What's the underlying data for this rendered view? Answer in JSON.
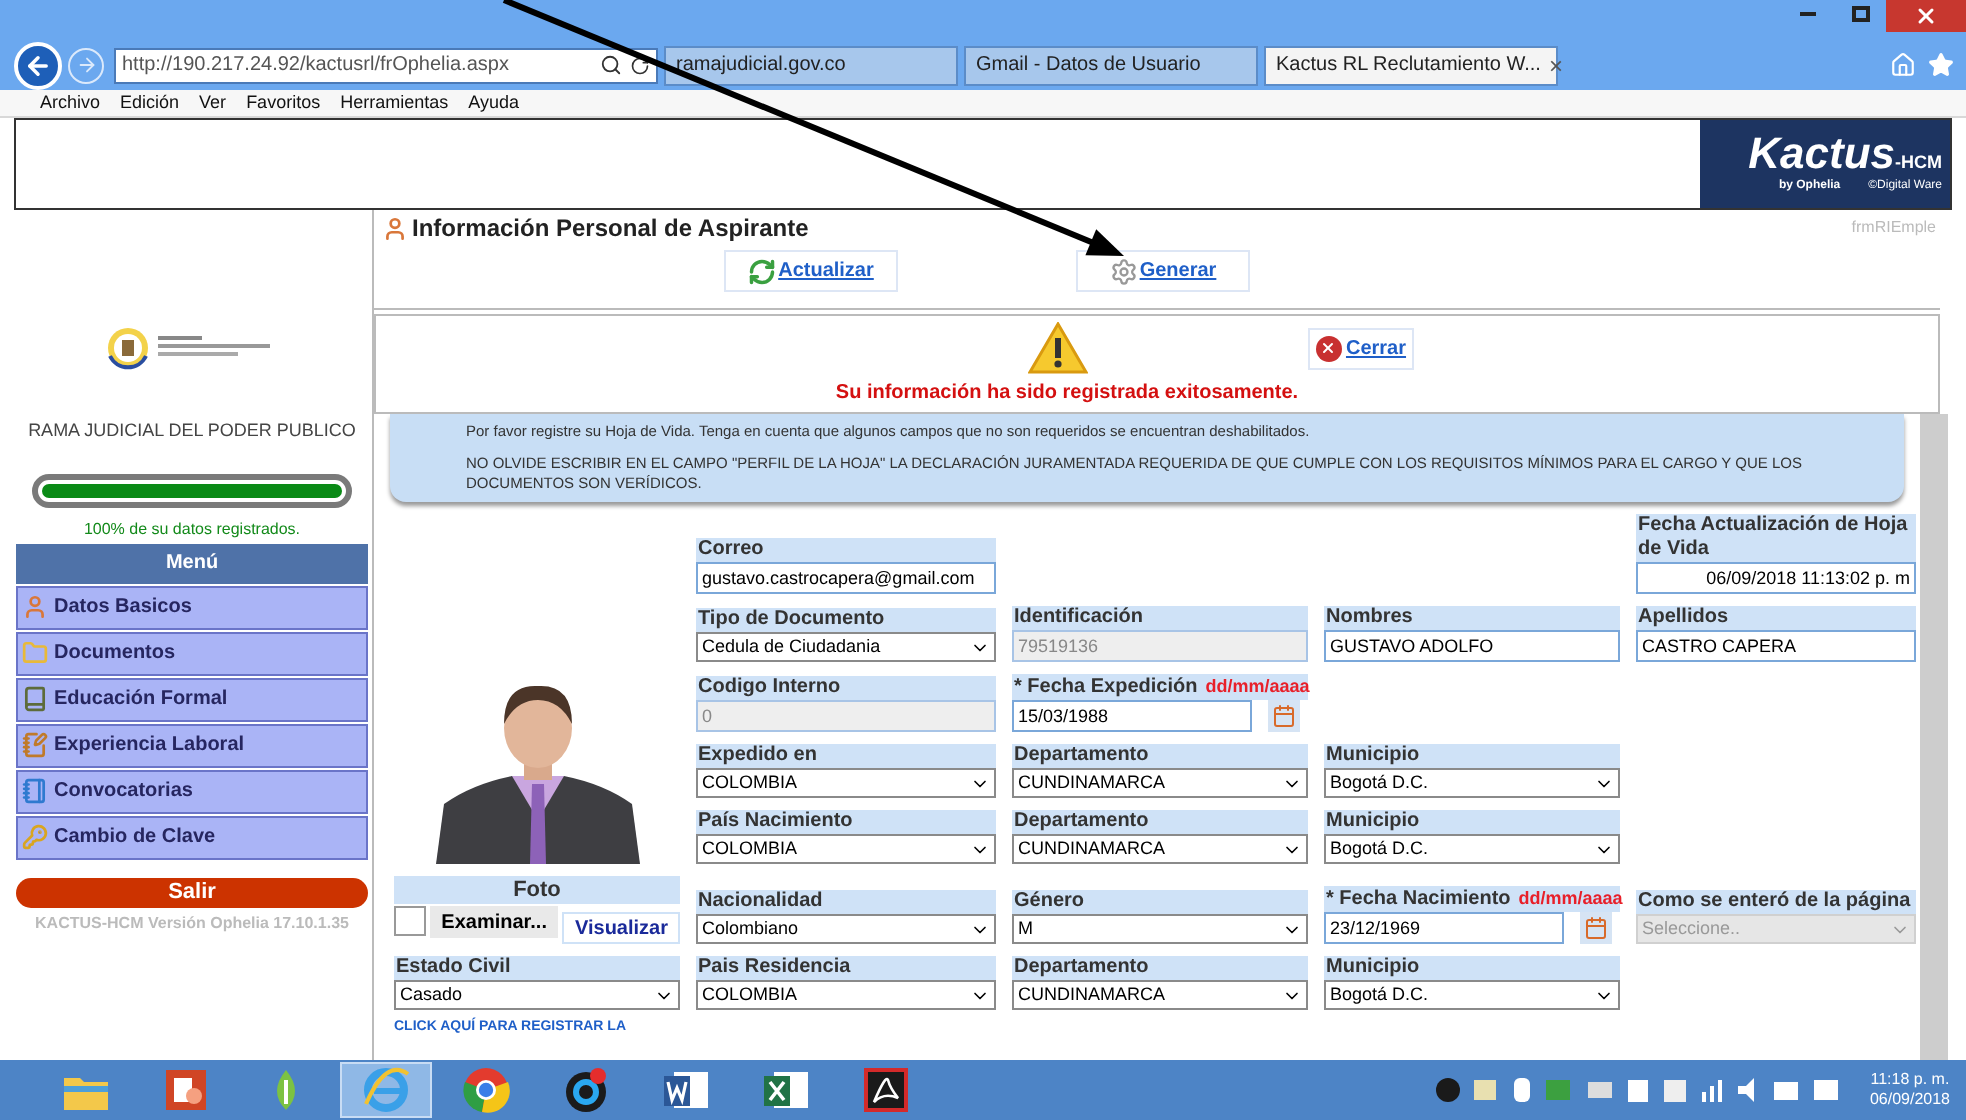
{
  "browser": {
    "url": "http://190.217.24.92/kactusrl/frOphelia.aspx",
    "tabs": [
      {
        "title": "ramajudicial.gov.co",
        "selected": false
      },
      {
        "title": "Gmail - Datos de Usuario",
        "selected": false
      },
      {
        "title": "Kactus RL Reclutamiento W...",
        "selected": true,
        "close": "×"
      }
    ],
    "menu": [
      "Archivo",
      "Edición",
      "Ver",
      "Favoritos",
      "Herramientas",
      "Ayuda"
    ]
  },
  "logo": {
    "name": "Kactus",
    "suffix": "-HCM",
    "tagline": "by Ophelia",
    "credit": "©Digital Ware"
  },
  "sidebar": {
    "organization": "RAMA JUDICIAL DEL PODER PUBLICO",
    "progress": {
      "level": 1,
      "caption": "100% de su datos registrados."
    },
    "menu_title": "Menú",
    "items": [
      {
        "label": "Datos Basicos",
        "kind": "user"
      },
      {
        "label": "Documentos",
        "kind": "folder"
      },
      {
        "label": "Educación Formal",
        "kind": "book"
      },
      {
        "label": "Experiencia Laboral",
        "kind": "notebook"
      },
      {
        "label": "Convocatorias",
        "kind": "binder"
      },
      {
        "label": "Cambio de Clave",
        "kind": "key"
      }
    ],
    "logout": "Salir",
    "version": "KACTUS-HCM Versión Ophelia 17.10.1.35"
  },
  "page": {
    "title": "Información Personal de Aspirante",
    "form_id": "frmRIEmple",
    "actions": [
      {
        "label": "Actualizar",
        "kind": "refresh"
      },
      {
        "label": "Generar",
        "kind": "gear"
      }
    ],
    "message": {
      "text": "Su información ha sido registrada exitosamente.",
      "close": "Cerrar"
    },
    "notices": [
      "Por favor registre su Hoja de Vida. Tenga en cuenta que algunos campos que no son requeridos se encuentran deshabilitados.",
      "NO OLVIDE ESCRIBIR EN EL CAMPO \"PERFIL DE LA HOJA\" LA DECLARACIÓN JURAMENTADA REQUERIDA DE QUE CUMPLE CON LOS REQUISITOS MÍNIMOS PARA EL CARGO Y QUE LOS DOCUMENTOS SON VERÍDICOS."
    ]
  },
  "form": {
    "photo": {
      "kind": "picture"
    },
    "rows": [
      [
        {
          "kind": "input",
          "label": "Correo",
          "value": "gustavo.castrocapera@gmail.com",
          "disabled": false
        },
        {
          "kind": "empty"
        },
        {
          "kind": "empty"
        },
        {
          "kind": "timestamp",
          "label": "Fecha Actualización de Hoja de Vida",
          "value": "06/09/2018 11:13:02 p. m",
          "disabled": false
        }
      ],
      [
        {
          "kind": "select",
          "label": "Tipo de Documento",
          "value": "Cedula de Ciudadania",
          "disabled": false
        },
        {
          "kind": "input",
          "label": "Identificación",
          "value": "79519136",
          "disabled": true
        },
        {
          "kind": "input",
          "label": "Nombres",
          "value": "GUSTAVO ADOLFO",
          "disabled": false
        },
        {
          "kind": "input",
          "label": "Apellidos",
          "value": "CASTRO CAPERA",
          "disabled": false
        }
      ],
      [
        {
          "kind": "input",
          "label": "Codigo Interno",
          "value": "0",
          "disabled": true
        },
        {
          "kind": "date",
          "label": "* Fecha Expedición",
          "hint": "dd/mm/aaaa",
          "value": "15/03/1988",
          "disabled": false
        },
        {
          "kind": "empty"
        },
        {
          "kind": "empty"
        }
      ],
      [
        {
          "kind": "select",
          "label": "Expedido en",
          "value": "COLOMBIA",
          "disabled": false
        },
        {
          "kind": "select",
          "label": "Departamento",
          "value": "CUNDINAMARCA",
          "disabled": false
        },
        {
          "kind": "select",
          "label": "Municipio",
          "value": "Bogotá D.C.",
          "disabled": false
        },
        {
          "kind": "empty"
        }
      ],
      [
        {
          "kind": "select",
          "label": "País Nacimiento",
          "value": "COLOMBIA",
          "disabled": false
        },
        {
          "kind": "select",
          "label": "Departamento",
          "value": "CUNDINAMARCA",
          "disabled": false
        },
        {
          "kind": "select",
          "label": "Municipio",
          "value": "Bogotá D.C.",
          "disabled": false
        },
        {
          "kind": "empty"
        }
      ],
      [
        {
          "kind": "upload",
          "label": "Foto",
          "browse": "Examinar...",
          "view": "Visualizar"
        },
        {
          "kind": "select",
          "label": "Nacionalidad",
          "value": "Colombiano",
          "disabled": false
        },
        {
          "kind": "select",
          "label": "Género",
          "value": "M",
          "disabled": false
        },
        {
          "kind": "date",
          "label": "* Fecha Nacimiento",
          "hint": "dd/mm/aaaa",
          "value": "23/12/1969",
          "disabled": false
        },
        {
          "kind": "select",
          "label": "Como se enteró de la página",
          "placeholder": "Seleccione..",
          "disabled": true
        }
      ],
      [
        {
          "kind": "select",
          "label": "Estado Civil",
          "value": "Casado",
          "disabled": false
        },
        {
          "kind": "select",
          "label": "Pais Residencia",
          "value": "COLOMBIA",
          "disabled": false
        },
        {
          "kind": "select",
          "label": "Departamento",
          "value": "CUNDINAMARCA",
          "disabled": false
        },
        {
          "kind": "select",
          "label": "Municipio",
          "value": "Bogotá D.C.",
          "disabled": false
        }
      ]
    ],
    "link": "CLICK AQUÍ PARA REGISTRAR LA"
  },
  "taskbar": {
    "apps": [
      {
        "selected": false
      },
      {
        "selected": false
      },
      {
        "selected": false
      },
      {
        "selected": true
      },
      {
        "selected": false
      },
      {
        "selected": false
      },
      {
        "selected": false
      },
      {
        "selected": false
      },
      {
        "selected": false
      }
    ],
    "time": "11:18 p. m.",
    "date": "06/09/2018"
  }
}
